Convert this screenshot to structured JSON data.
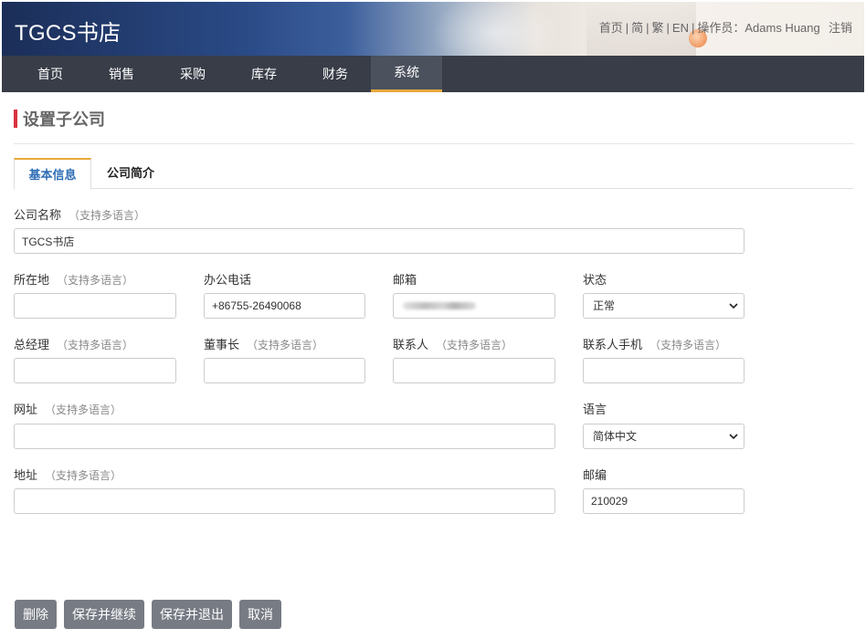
{
  "header": {
    "brand": "TGCS书店",
    "links": {
      "home": "首页",
      "simplified": "简",
      "traditional": "繁",
      "english": "EN",
      "operator": "操作员：Adams Huang",
      "logout": "注销"
    },
    "separator": "|"
  },
  "nav": {
    "items": [
      {
        "label": "首页"
      },
      {
        "label": "销售"
      },
      {
        "label": "采购"
      },
      {
        "label": "库存"
      },
      {
        "label": "财务"
      },
      {
        "label": "系统"
      }
    ],
    "active_index": 5
  },
  "page": {
    "title": "设置子公司"
  },
  "tabs": [
    {
      "label": "基本信息"
    },
    {
      "label": "公司简介"
    }
  ],
  "form": {
    "multilang_hint": "（支持多语言）",
    "company_name": {
      "label": "公司名称",
      "value": "TGCS书店"
    },
    "location": {
      "label": "所在地",
      "value": ""
    },
    "office_phone": {
      "label": "办公电话",
      "value": "+86755-26490068"
    },
    "email": {
      "label": "邮箱",
      "value": ""
    },
    "status": {
      "label": "状态",
      "value": "正常"
    },
    "general_manager": {
      "label": "总经理",
      "value": ""
    },
    "chairman": {
      "label": "董事长",
      "value": ""
    },
    "contact": {
      "label": "联系人",
      "value": ""
    },
    "contact_mobile": {
      "label": "联系人手机",
      "value": ""
    },
    "website": {
      "label": "网址",
      "value": ""
    },
    "language": {
      "label": "语言",
      "value": "简体中文"
    },
    "address": {
      "label": "地址",
      "value": ""
    },
    "postcode": {
      "label": "邮编",
      "value": "210029"
    }
  },
  "buttons": {
    "delete": "删除",
    "save_continue": "保存并继续",
    "save_exit": "保存并退出",
    "cancel": "取消"
  },
  "colors": {
    "nav_bg": "#383d48",
    "nav_active_underline": "#e7a83a",
    "title_accent": "#d9313e",
    "tab_active_text": "#2f6db5",
    "button_bg": "#777b84"
  }
}
